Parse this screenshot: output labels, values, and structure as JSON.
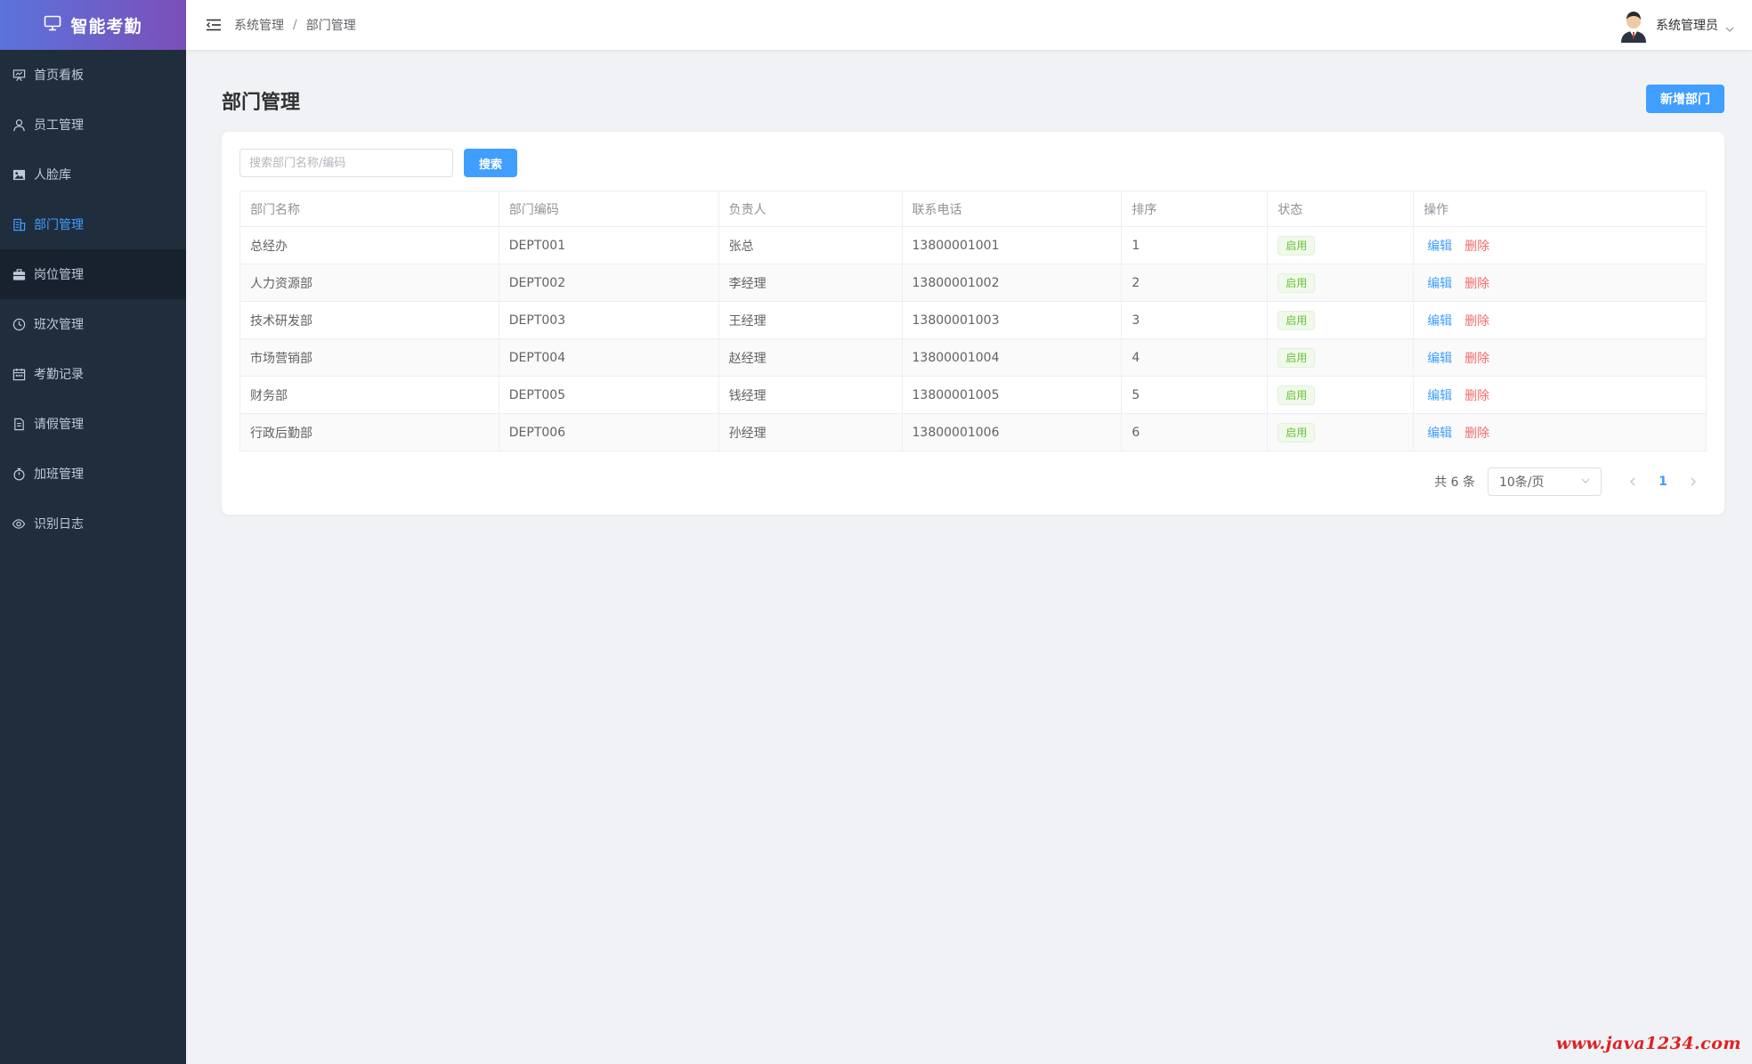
{
  "app": {
    "title": "智能考勤"
  },
  "sidebar": {
    "items": [
      {
        "label": "首页看板",
        "icon": "presentation-icon"
      },
      {
        "label": "员工管理",
        "icon": "user-icon"
      },
      {
        "label": "人脸库",
        "icon": "picture-icon"
      },
      {
        "label": "部门管理",
        "icon": "office-building-icon",
        "active": true
      },
      {
        "label": "岗位管理",
        "icon": "briefcase-icon",
        "hover": true
      },
      {
        "label": "班次管理",
        "icon": "clock-icon"
      },
      {
        "label": "考勤记录",
        "icon": "calendar-icon"
      },
      {
        "label": "请假管理",
        "icon": "document-icon"
      },
      {
        "label": "加班管理",
        "icon": "stopwatch-icon"
      },
      {
        "label": "识别日志",
        "icon": "eye-icon"
      }
    ]
  },
  "header": {
    "breadcrumb": [
      "系统管理",
      "部门管理"
    ],
    "separator": "/",
    "user_name": "系统管理员"
  },
  "page": {
    "title": "部门管理",
    "add_button": "新增部门",
    "search_placeholder": "搜索部门名称/编码",
    "search_button": "搜索"
  },
  "table": {
    "columns": [
      "部门名称",
      "部门编码",
      "负责人",
      "联系电话",
      "排序",
      "状态",
      "操作"
    ],
    "rows": [
      {
        "name": "总经办",
        "code": "DEPT001",
        "leader": "张总",
        "phone": "13800001001",
        "sort": "1",
        "status": "启用"
      },
      {
        "name": "人力资源部",
        "code": "DEPT002",
        "leader": "李经理",
        "phone": "13800001002",
        "sort": "2",
        "status": "启用"
      },
      {
        "name": "技术研发部",
        "code": "DEPT003",
        "leader": "王经理",
        "phone": "13800001003",
        "sort": "3",
        "status": "启用"
      },
      {
        "name": "市场营销部",
        "code": "DEPT004",
        "leader": "赵经理",
        "phone": "13800001004",
        "sort": "4",
        "status": "启用"
      },
      {
        "name": "财务部",
        "code": "DEPT005",
        "leader": "钱经理",
        "phone": "13800001005",
        "sort": "5",
        "status": "启用"
      },
      {
        "name": "行政后勤部",
        "code": "DEPT006",
        "leader": "孙经理",
        "phone": "13800001006",
        "sort": "6",
        "status": "启用"
      }
    ],
    "edit_label": "编辑",
    "delete_label": "删除"
  },
  "pagination": {
    "total_text": "共 6 条",
    "page_size": "10条/页",
    "current_page": "1"
  },
  "watermark": "www.java1234.com",
  "colors": {
    "primary": "#409eff",
    "danger": "#f56c6c",
    "success": "#67c23a",
    "sidebar_bg": "#1f2d3d",
    "logo_gradient_start": "#5b73dc",
    "logo_gradient_end": "#7b4fb8"
  }
}
